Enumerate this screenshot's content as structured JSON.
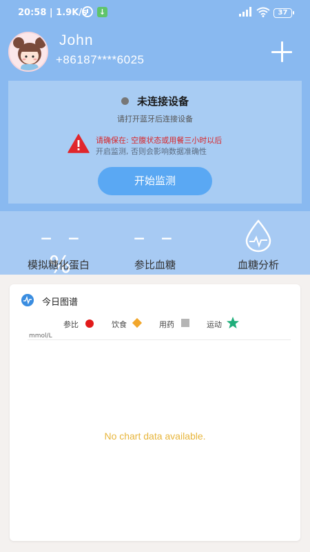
{
  "status_bar": {
    "time": "20:58 | 1.9K/s",
    "battery": "37"
  },
  "profile": {
    "name": "John",
    "phone": "+86187****6025"
  },
  "device": {
    "status": "未连接设备",
    "hint": "请打开蓝牙后连接设备",
    "warning_line1": "请确保在: 空腹状态或用餐三小时以后",
    "warning_line2": "开启监测, 否则会影响数据准确性",
    "start_button": "开始监测"
  },
  "stats": [
    {
      "value": "– – %",
      "label": "模拟糖化蛋白"
    },
    {
      "value": "– –",
      "label": "参比血糖"
    },
    {
      "label": "血糖分析"
    }
  ],
  "chart": {
    "title": "今日图谱",
    "legend": [
      "参比",
      "饮食",
      "用药",
      "运动"
    ],
    "unit": "mmol/L",
    "empty_message": "No chart data available."
  },
  "colors": {
    "header_blue": "#89b9f0",
    "button_blue": "#5aa8f3",
    "warning_red": "#d8262a",
    "empty_text": "#e7b53b"
  }
}
